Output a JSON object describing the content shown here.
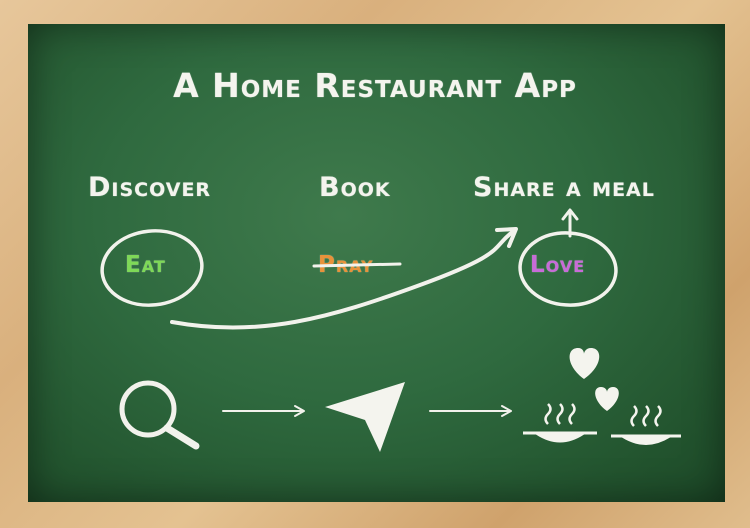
{
  "title": "A Home Restaurant App",
  "steps": [
    {
      "label": "Discover",
      "word": "Eat",
      "word_color": "#7ed957"
    },
    {
      "label": "Book",
      "word": "Pray",
      "word_color": "#e8923a"
    },
    {
      "label": "Share a meal",
      "word": "Love",
      "word_color": "#c86bd8"
    }
  ],
  "icons": [
    "magnifier-icon",
    "arrow-right-icon",
    "paper-plane-icon",
    "arrow-right-icon",
    "steaming-plate-icon",
    "heart-icon",
    "heart-icon",
    "steaming-plate-icon"
  ]
}
